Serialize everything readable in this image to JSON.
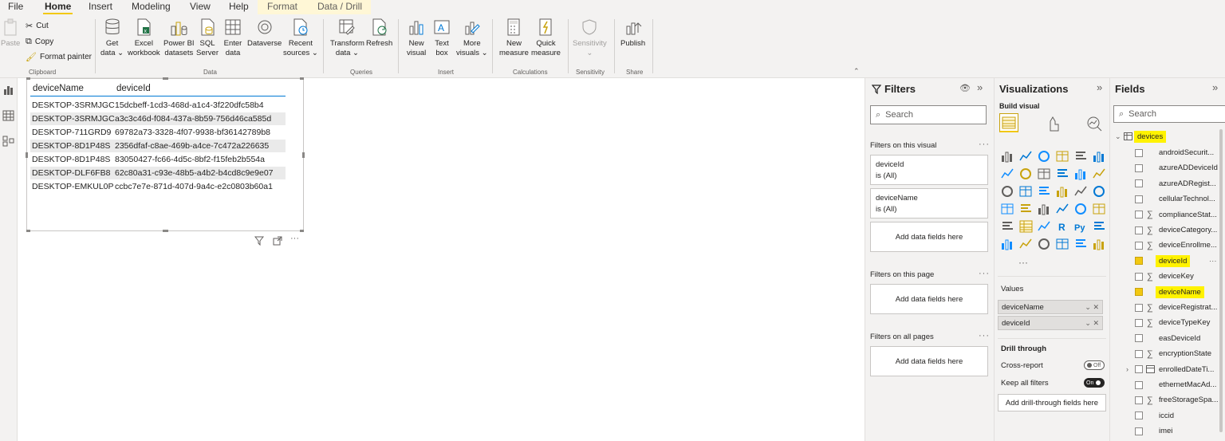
{
  "menu": {
    "tabs": [
      "File",
      "Home",
      "Insert",
      "Modeling",
      "View",
      "Help",
      "Format",
      "Data / Drill"
    ],
    "active": "Home"
  },
  "ribbon": {
    "clipboard": {
      "paste": "Paste",
      "cut": "Cut",
      "copy": "Copy",
      "format_painter": "Format painter",
      "group": "Clipboard"
    },
    "data": {
      "get_data": [
        "Get",
        "data ⌄"
      ],
      "excel": [
        "Excel",
        "workbook"
      ],
      "powerbi": [
        "Power BI",
        "datasets"
      ],
      "sql": [
        "SQL",
        "Server"
      ],
      "enter": [
        "Enter",
        "data"
      ],
      "dataverse": [
        "Dataverse",
        ""
      ],
      "recent": [
        "Recent",
        "sources ⌄"
      ],
      "group": "Data"
    },
    "queries": {
      "transform": [
        "Transform",
        "data ⌄"
      ],
      "refresh": [
        "Refresh",
        ""
      ],
      "group": "Queries"
    },
    "insert": {
      "new_visual": [
        "New",
        "visual"
      ],
      "text_box": [
        "Text",
        "box"
      ],
      "more": [
        "More",
        "visuals ⌄"
      ],
      "group": "Insert"
    },
    "calculations": {
      "new_measure": [
        "New",
        "measure"
      ],
      "quick": [
        "Quick",
        "measure"
      ],
      "group": "Calculations"
    },
    "sensitivity": {
      "label": [
        "Sensitivity",
        "⌄"
      ],
      "group": "Sensitivity"
    },
    "share": {
      "publish": [
        "Publish",
        ""
      ],
      "group": "Share"
    }
  },
  "table": {
    "columns": [
      "deviceName",
      "deviceId"
    ],
    "rows": [
      [
        "DESKTOP-3SRMJGC",
        "15dcbeff-1cd3-468d-a1c4-3f220dfc58b4"
      ],
      [
        "DESKTOP-3SRMJGC",
        "a3c3c46d-f084-437a-8b59-756d46ca585d"
      ],
      [
        "DESKTOP-711GRD9",
        "69782a73-3328-4f07-9938-bf36142789b8"
      ],
      [
        "DESKTOP-8D1P48S",
        "2356dfaf-c8ae-469b-a4ce-7c472a226635"
      ],
      [
        "DESKTOP-8D1P48S",
        "83050427-fc66-4d5c-8bf2-f15feb2b554a"
      ],
      [
        "DESKTOP-DLF6FB8",
        "62c80a31-c93e-48b5-a4b2-b4cd8c9e9e07"
      ],
      [
        "DESKTOP-EMKUL0P",
        "ccbc7e7e-871d-407d-9a4c-e2c0803b60a1"
      ]
    ]
  },
  "filters": {
    "title": "Filters",
    "search": "Search",
    "on_visual": "Filters on this visual",
    "cards": [
      {
        "field": "deviceId",
        "value": "is (All)"
      },
      {
        "field": "deviceName",
        "value": "is (All)"
      }
    ],
    "add": "Add data fields here",
    "on_page": "Filters on this page",
    "on_all": "Filters on all pages"
  },
  "viz": {
    "title": "Visualizations",
    "build": "Build visual",
    "values": "Values",
    "wells": [
      "deviceName",
      "deviceId"
    ],
    "drill": "Drill through",
    "cross": "Cross-report",
    "cross_state": "Off",
    "keep": "Keep all filters",
    "keep_state": "On",
    "add_drill": "Add drill-through fields here",
    "more": "···"
  },
  "fields": {
    "title": "Fields",
    "search": "Search",
    "table": "devices",
    "items": [
      {
        "name": "androidSecurit...",
        "sigma": false,
        "checked": false
      },
      {
        "name": "azureADDeviceId",
        "sigma": false,
        "checked": false
      },
      {
        "name": "azureADRegist...",
        "sigma": false,
        "checked": false
      },
      {
        "name": "cellularTechnol...",
        "sigma": false,
        "checked": false
      },
      {
        "name": "complianceStat...",
        "sigma": true,
        "checked": false
      },
      {
        "name": "deviceCategory...",
        "sigma": true,
        "checked": false
      },
      {
        "name": "deviceEnrollme...",
        "sigma": true,
        "checked": false
      },
      {
        "name": "deviceId",
        "sigma": false,
        "checked": true
      },
      {
        "name": "deviceKey",
        "sigma": true,
        "checked": false
      },
      {
        "name": "deviceName",
        "sigma": false,
        "checked": true
      },
      {
        "name": "deviceRegistrat...",
        "sigma": true,
        "checked": false
      },
      {
        "name": "deviceTypeKey",
        "sigma": true,
        "checked": false
      },
      {
        "name": "easDeviceId",
        "sigma": false,
        "checked": false
      },
      {
        "name": "encryptionState",
        "sigma": true,
        "checked": false
      },
      {
        "name": "enrolledDateTi...",
        "sigma": false,
        "checked": false,
        "table": true
      },
      {
        "name": "ethernetMacAd...",
        "sigma": false,
        "checked": false
      },
      {
        "name": "freeStorageSpa...",
        "sigma": true,
        "checked": false
      },
      {
        "name": "iccid",
        "sigma": false,
        "checked": false
      },
      {
        "name": "imei",
        "sigma": false,
        "checked": false
      }
    ]
  },
  "colors": {
    "accent": "#f2c811",
    "highlight": "#fff200",
    "selection": "#0078d4"
  }
}
